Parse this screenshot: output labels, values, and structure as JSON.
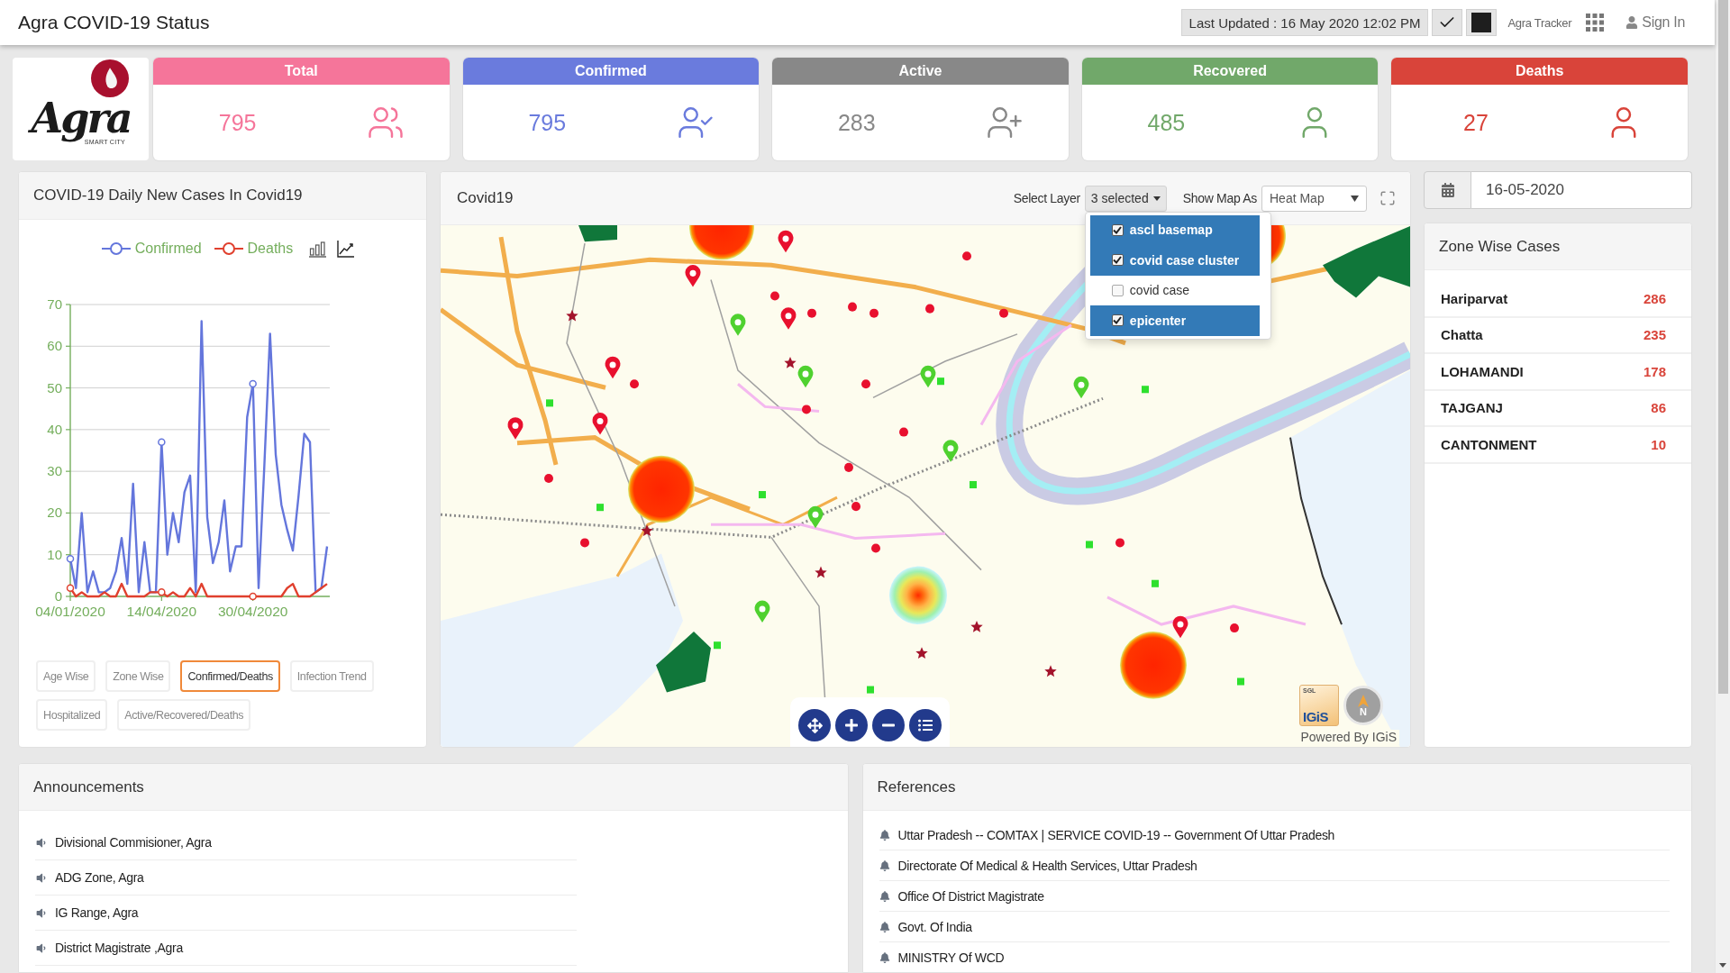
{
  "header": {
    "title": "Agra COVID-19 Status",
    "last_updated": "Last Updated : 16 May 2020 12:02 PM",
    "tracker_label": "Agra Tracker",
    "sign_in": "Sign In"
  },
  "logo": {
    "word": "Agra",
    "tagline": "SMART CITY"
  },
  "stats": [
    {
      "kind": "total",
      "label": "Total",
      "value": "795",
      "color": "#f5759a"
    },
    {
      "kind": "confirmed",
      "label": "Confirmed",
      "value": "795",
      "color": "#6a7bdd"
    },
    {
      "kind": "active",
      "label": "Active",
      "value": "283",
      "color": "#888888"
    },
    {
      "kind": "recovered",
      "label": "Recovered",
      "value": "485",
      "color": "#71a86a"
    },
    {
      "kind": "deaths",
      "label": "Deaths",
      "value": "27",
      "color": "#d9443a"
    }
  ],
  "daily_chart": {
    "title": "COVID-19 Daily New Cases In Covid19",
    "chart_data": {
      "type": "line",
      "grid": true,
      "categories": [
        "04/01/2020",
        null,
        null,
        null,
        null,
        null,
        null,
        null,
        null,
        null,
        null,
        null,
        null,
        null,
        null,
        null,
        "14/04/2020",
        null,
        null,
        null,
        null,
        null,
        null,
        null,
        null,
        null,
        null,
        null,
        null,
        null,
        null,
        null,
        "30/04/2020",
        null,
        null,
        null,
        null,
        null,
        null,
        null,
        null,
        null,
        null,
        null,
        null,
        null
      ],
      "ylim": [
        0,
        70
      ],
      "yticks": [
        0,
        10,
        20,
        30,
        40,
        50,
        60,
        70
      ],
      "series": [
        {
          "name": "Confirmed",
          "color": "#6476dc",
          "values": [
            9,
            2,
            20,
            1,
            6,
            1,
            1,
            2,
            6,
            14,
            3,
            27,
            1,
            13,
            1,
            1,
            37,
            10,
            20,
            13,
            25,
            29,
            1,
            66,
            19,
            8,
            13,
            23,
            6,
            12,
            12,
            43,
            51,
            2,
            31,
            63,
            34,
            22,
            16,
            11,
            24,
            39,
            37,
            1,
            2,
            12
          ]
        },
        {
          "name": "Deaths",
          "color": "#e0402e",
          "values": [
            2,
            0,
            1,
            0,
            0,
            0,
            1,
            0,
            0,
            3,
            0,
            0,
            0,
            0,
            1,
            1,
            1,
            0,
            1,
            0,
            0,
            2,
            0,
            3,
            0,
            0,
            0,
            0,
            0,
            0,
            0,
            0,
            0,
            0,
            0,
            0,
            0,
            0,
            2,
            3,
            0,
            0,
            0,
            1,
            2,
            3
          ]
        }
      ]
    },
    "views": [
      {
        "label": "Age Wise",
        "selected": false
      },
      {
        "label": "Zone Wise",
        "selected": false
      },
      {
        "label": "Confirmed/Deaths",
        "selected": true
      },
      {
        "label": "Infection Trend",
        "selected": false
      },
      {
        "label": "Hospitalized",
        "selected": false
      },
      {
        "label": "Active/Recovered/Deaths",
        "selected": false
      }
    ]
  },
  "map_panel": {
    "title": "Covid19",
    "layer_label": "Select Layer",
    "layer_button": "3 selected",
    "layers": [
      {
        "label": "ascl basemap",
        "checked": true
      },
      {
        "label": "covid case cluster",
        "checked": true
      },
      {
        "label": "covid case",
        "checked": false
      },
      {
        "label": "epicenter",
        "checked": true
      }
    ],
    "view_label": "Show Map As",
    "view_value": "Heat Map",
    "brand": {
      "small": "SGL",
      "name": "IGiS",
      "compass": "N"
    },
    "powered_by": "Powered By IGiS"
  },
  "date": {
    "value": "16-05-2020"
  },
  "zones": {
    "title": "Zone Wise Cases",
    "rows": [
      {
        "name": "Hariparvat",
        "count": "286"
      },
      {
        "name": "Chatta",
        "count": "235"
      },
      {
        "name": "LOHAMANDI",
        "count": "178"
      },
      {
        "name": "TAJGANJ",
        "count": "86"
      },
      {
        "name": "CANTONMENT",
        "count": "10"
      }
    ]
  },
  "announcements": {
    "title": "Announcements",
    "items": [
      "Divisional Commisioner, Agra",
      "ADG Zone, Agra",
      "IG Range, Agra",
      "District Magistrate ,Agra"
    ]
  },
  "references": {
    "title": "References",
    "items": [
      "Uttar Pradesh -- COMTAX | SERVICE COVID-19 -- Government Of Uttar Pradesh",
      "Directorate Of Medical & Health Services, Uttar Pradesh",
      "Office Of District Magistrate",
      "Govt. Of India",
      "MINISTRY Of WCD"
    ]
  }
}
